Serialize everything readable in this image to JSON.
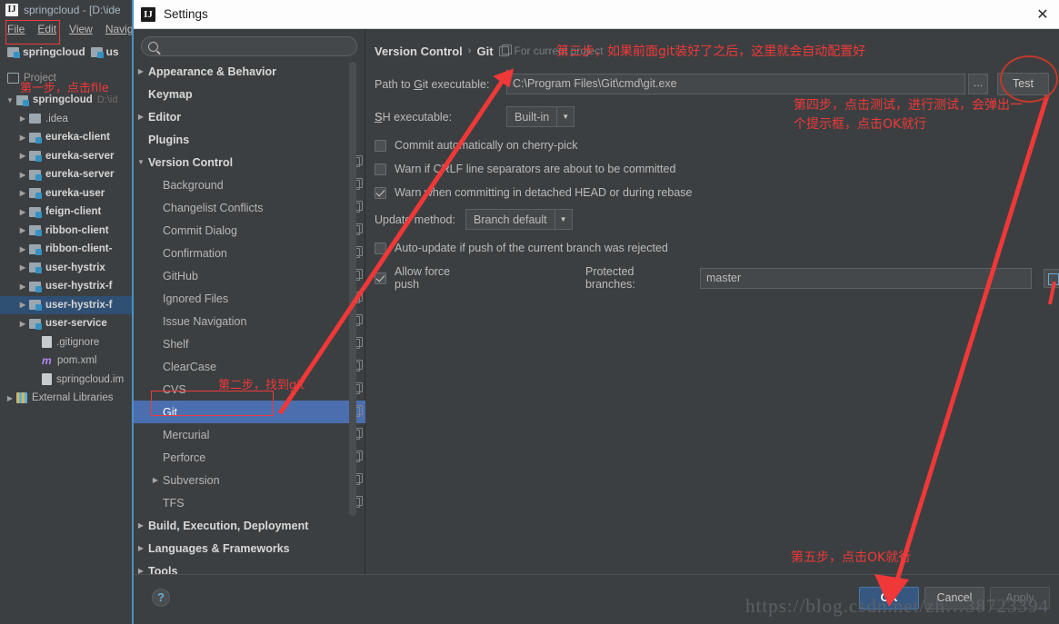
{
  "ide": {
    "title": "springcloud - [D:\\ide",
    "logo_text": "IJ",
    "menus": [
      {
        "label": "File"
      },
      {
        "label": "Edit"
      },
      {
        "label": "View"
      },
      {
        "label": "Navig"
      }
    ],
    "breadcrumbs": [
      {
        "label": "springcloud"
      },
      {
        "label": "us"
      }
    ],
    "project_tab": "Project",
    "tree": [
      {
        "label": "springcloud",
        "path": "D:\\id",
        "indent": 0,
        "twisty": "▼",
        "icon": "module-icon",
        "bold": true
      },
      {
        "label": ".idea",
        "path": "",
        "indent": 1,
        "twisty": "▶",
        "icon": "folder-icon",
        "bold": false
      },
      {
        "label": "eureka-client",
        "path": "",
        "indent": 1,
        "twisty": "▶",
        "icon": "module-icon",
        "bold": true
      },
      {
        "label": "eureka-server",
        "path": "",
        "indent": 1,
        "twisty": "▶",
        "icon": "module-icon",
        "bold": true
      },
      {
        "label": "eureka-server",
        "path": "",
        "indent": 1,
        "twisty": "▶",
        "icon": "module-icon",
        "bold": true
      },
      {
        "label": "eureka-user",
        "path": "",
        "indent": 1,
        "twisty": "▶",
        "icon": "module-icon",
        "bold": true
      },
      {
        "label": "feign-client",
        "path": "",
        "indent": 1,
        "twisty": "▶",
        "icon": "module-icon",
        "bold": true
      },
      {
        "label": "ribbon-client",
        "path": "",
        "indent": 1,
        "twisty": "▶",
        "icon": "module-icon",
        "bold": true
      },
      {
        "label": "ribbon-client-",
        "path": "",
        "indent": 1,
        "twisty": "▶",
        "icon": "module-icon",
        "bold": true
      },
      {
        "label": "user-hystrix",
        "path": "",
        "indent": 1,
        "twisty": "▶",
        "icon": "module-icon",
        "bold": true
      },
      {
        "label": "user-hystrix-f",
        "path": "",
        "indent": 1,
        "twisty": "▶",
        "icon": "module-icon",
        "bold": true
      },
      {
        "label": "user-hystrix-f",
        "path": "",
        "indent": 1,
        "twisty": "▶",
        "icon": "module-icon",
        "bold": true,
        "selected": true
      },
      {
        "label": "user-service",
        "path": "",
        "indent": 1,
        "twisty": "▶",
        "icon": "module-icon",
        "bold": true
      },
      {
        "label": ".gitignore",
        "path": "",
        "indent": 2,
        "twisty": "",
        "icon": "file-icon",
        "bold": false
      },
      {
        "label": "pom.xml",
        "path": "",
        "indent": 2,
        "twisty": "",
        "icon": "maven-icon",
        "bold": false
      },
      {
        "label": "springcloud.im",
        "path": "",
        "indent": 2,
        "twisty": "",
        "icon": "file-icon",
        "bold": false
      },
      {
        "label": "External Libraries",
        "path": "",
        "indent": 0,
        "twisty": "▶",
        "icon": "library-icon",
        "bold": false
      }
    ]
  },
  "dialog": {
    "title": "Settings",
    "logo_text": "IJ",
    "close_label": "✕",
    "search": {
      "value": "",
      "placeholder": ""
    },
    "nav": [
      {
        "label": "Appearance & Behavior",
        "level": 0,
        "twisty": "▶",
        "copy": false,
        "top": true
      },
      {
        "label": "Keymap",
        "level": 0,
        "twisty": "",
        "copy": false,
        "top": true
      },
      {
        "label": "Editor",
        "level": 0,
        "twisty": "▶",
        "copy": false,
        "top": true
      },
      {
        "label": "Plugins",
        "level": 0,
        "twisty": "",
        "copy": false,
        "top": true
      },
      {
        "label": "Version Control",
        "level": 0,
        "twisty": "▼",
        "copy": true,
        "top": true
      },
      {
        "label": "Background",
        "level": 1,
        "twisty": "",
        "copy": true,
        "top": false
      },
      {
        "label": "Changelist Conflicts",
        "level": 1,
        "twisty": "",
        "copy": true,
        "top": false
      },
      {
        "label": "Commit Dialog",
        "level": 1,
        "twisty": "",
        "copy": true,
        "top": false
      },
      {
        "label": "Confirmation",
        "level": 1,
        "twisty": "",
        "copy": true,
        "top": false
      },
      {
        "label": "GitHub",
        "level": 1,
        "twisty": "",
        "copy": true,
        "top": false
      },
      {
        "label": "Ignored Files",
        "level": 1,
        "twisty": "",
        "copy": true,
        "top": false
      },
      {
        "label": "Issue Navigation",
        "level": 1,
        "twisty": "",
        "copy": true,
        "top": false
      },
      {
        "label": "Shelf",
        "level": 1,
        "twisty": "",
        "copy": true,
        "top": false
      },
      {
        "label": "ClearCase",
        "level": 1,
        "twisty": "",
        "copy": true,
        "top": false
      },
      {
        "label": "CVS",
        "level": 1,
        "twisty": "",
        "copy": true,
        "top": false
      },
      {
        "label": "Git",
        "level": 1,
        "twisty": "",
        "copy": true,
        "top": false,
        "selected": true
      },
      {
        "label": "Mercurial",
        "level": 1,
        "twisty": "",
        "copy": true,
        "top": false
      },
      {
        "label": "Perforce",
        "level": 1,
        "twisty": "",
        "copy": true,
        "top": false
      },
      {
        "label": "Subversion",
        "level": 1,
        "twisty": "▶",
        "copy": true,
        "top": false
      },
      {
        "label": "TFS",
        "level": 1,
        "twisty": "",
        "copy": true,
        "top": false
      },
      {
        "label": "Build, Execution, Deployment",
        "level": 0,
        "twisty": "▶",
        "copy": false,
        "top": true
      },
      {
        "label": "Languages & Frameworks",
        "level": 0,
        "twisty": "▶",
        "copy": false,
        "top": true
      },
      {
        "label": "Tools",
        "level": 0,
        "twisty": "▶",
        "copy": false,
        "top": true
      }
    ],
    "main": {
      "breadcrumb_root": "Version Control",
      "breadcrumb_sep": "›",
      "breadcrumb_leaf": "Git",
      "scope_note": "For current project",
      "git_path_label_a": "Path to ",
      "git_path_label_u": "G",
      "git_path_label_b": "it executable:",
      "git_path_value": "C:\\Program Files\\Git\\cmd\\git.exe",
      "browse_label": "…",
      "test_label": "Test",
      "ssh_label_u": "S",
      "ssh_label_b": "SH executable:",
      "ssh_value": "Built-in",
      "cb_cherry_pick": "Commit automatically on cherry-pick",
      "cb_crlf": "Warn if CRLF line separators are about to be committed",
      "cb_detached": "Warn when committing in detached HEAD or during rebase",
      "update_method_label": "Update method:",
      "update_method_value": "Branch default",
      "cb_autoupdate": "Auto-update if push of the current branch was rejected",
      "cb_force_push": "Allow force push",
      "protected_label": "Protected branches:",
      "protected_value": "master",
      "checks": {
        "cherry_pick": false,
        "crlf": false,
        "detached": true,
        "autoupdate": false,
        "force_push": true
      }
    },
    "footer": {
      "help_label": "?",
      "ok_label": "OK",
      "cancel_label": "Cancel",
      "apply_label": "Apply"
    }
  },
  "annotations": {
    "step1": "第一步，点击file",
    "step2": "第二步，找到git",
    "step3": "第三步，如果前面git装好了之后，这里就会自动配置好",
    "step4_line1": "第四步，点击测试，进行测试，会弹出一",
    "step4_line2": "个提示框，点击OK就行",
    "step5": "第五步，点击OK就行",
    "watermark": "https://blog.csdn.net/zh…38723394",
    "color": "#f03838"
  }
}
